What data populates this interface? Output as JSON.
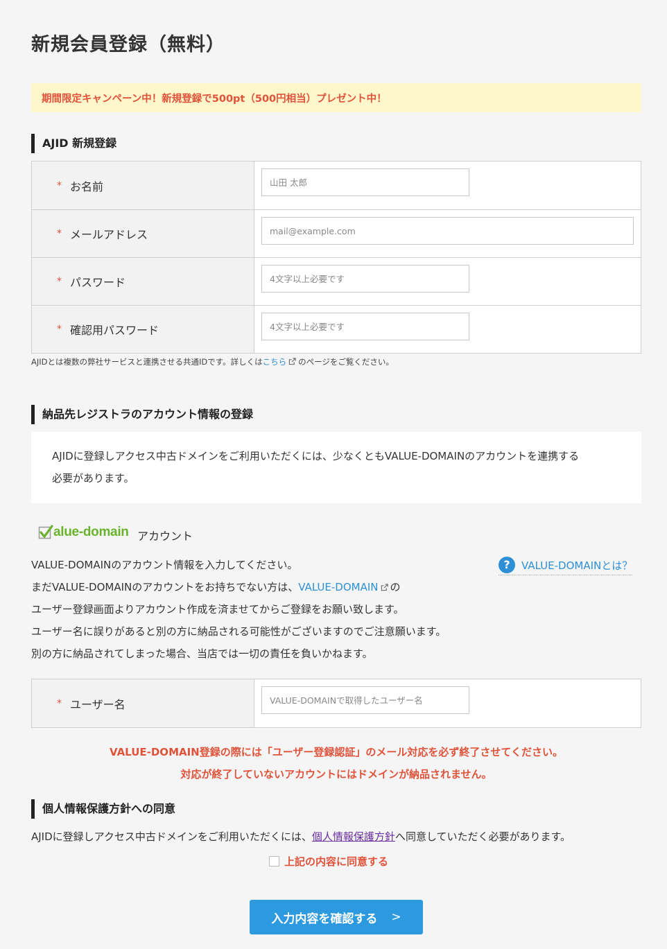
{
  "page_title": "新規会員登録（無料）",
  "campaign_banner": "期間限定キャンペーン中！新規登録で500pt（500円相当）プレゼント中！",
  "ajid_section": {
    "heading": "AJID 新規登録",
    "required_mark": "*",
    "fields": [
      {
        "label": "お名前",
        "placeholder": "山田 太郎"
      },
      {
        "label": "メールアドレス",
        "placeholder": "mail@example.com"
      },
      {
        "label": "パスワード",
        "placeholder": "4文字以上必要です"
      },
      {
        "label": "確認用パスワード",
        "placeholder": "4文字以上必要です"
      }
    ],
    "note_before": "AJIDとは複数の弊社サービスと連携させる共通IDです。詳しくは",
    "note_link": "こちら",
    "note_after": "のページをご覧ください。"
  },
  "registrar_section": {
    "heading": "納品先レジストラのアカウント情報の登録",
    "info_line1": "AJIDに登録しアクセス中古ドメインをご利用いただくには、少なくともVALUE-DOMAINのアカウントを連携する",
    "info_line2": "必要があります。",
    "logo_text": "alue-domain",
    "account_label": "アカウント",
    "help_link": "VALUE-DOMAINとは？",
    "para_line1": "VALUE-DOMAINのアカウント情報を入力してください。",
    "para_line2_before": "まだVALUE-DOMAINのアカウントをお持ちでない方は、",
    "para_line2_link": "VALUE-DOMAIN",
    "para_line2_after": "の",
    "para_line3": "ユーザー登録画面よりアカウント作成を済ませてからご登録をお願い致します。",
    "para_line4": "ユーザー名に誤りがあると別の方に納品される可能性がございますのでご注意願います。",
    "para_line5": "別の方に納品されてしまった場合、当店では一切の責任を負いかねます。",
    "username_label": "ユーザー名",
    "username_placeholder": "VALUE-DOMAINで取得したユーザー名",
    "warning_line1": "VALUE-DOMAIN登録の際には「ユーザー登録認証」のメール対応を必ず終了させてください。",
    "warning_line2": "対応が終了していないアカウントにはドメインが納品されません。"
  },
  "privacy_section": {
    "heading": "個人情報保護方針への同意",
    "text_before": "AJIDに登録しアクセス中古ドメインをご利用いただくには、",
    "link": "個人情報保護方針",
    "text_after": "へ同意していただく必要があります。",
    "agree_label": "上記の内容に同意する",
    "agree_checked": false
  },
  "submit": {
    "label": "入力内容を確認する",
    "chevron": ">"
  },
  "colors": {
    "accent_red": "#e0533b",
    "link_blue": "#2d8fd5",
    "button_blue": "#2d9ae0",
    "banner_bg": "#fff7cc",
    "logo_green": "#6ab42d"
  }
}
